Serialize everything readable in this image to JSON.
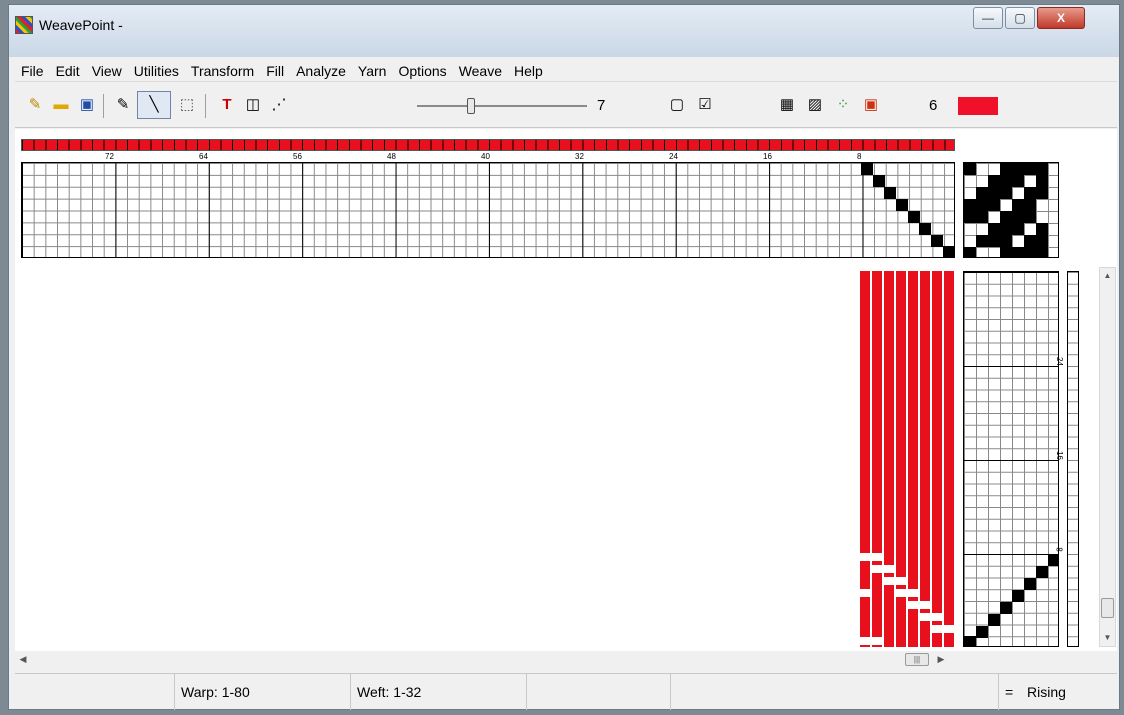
{
  "window": {
    "title": "WeavePoint -"
  },
  "title_controls": {
    "minimize": "—",
    "maximize": "▢",
    "close": "X"
  },
  "menu": [
    "File",
    "Edit",
    "View",
    "Utilities",
    "Transform",
    "Fill",
    "Analyze",
    "Yarn",
    "Options",
    "Weave",
    "Help"
  ],
  "toolbar": {
    "slider_value": "7",
    "shaft_count": "6",
    "current_color": "#f0102a"
  },
  "ruler_top": [
    "72",
    "64",
    "56",
    "48",
    "40",
    "32",
    "24",
    "16",
    "8"
  ],
  "ruler_side": [
    "24",
    "16",
    "8"
  ],
  "status": {
    "warp": "Warp: 1-80",
    "weft": "Weft: 1-32",
    "equals": "=",
    "mode": "Rising"
  },
  "colors": {
    "warp_color": "#e8101c",
    "accent": "#f0102a"
  }
}
